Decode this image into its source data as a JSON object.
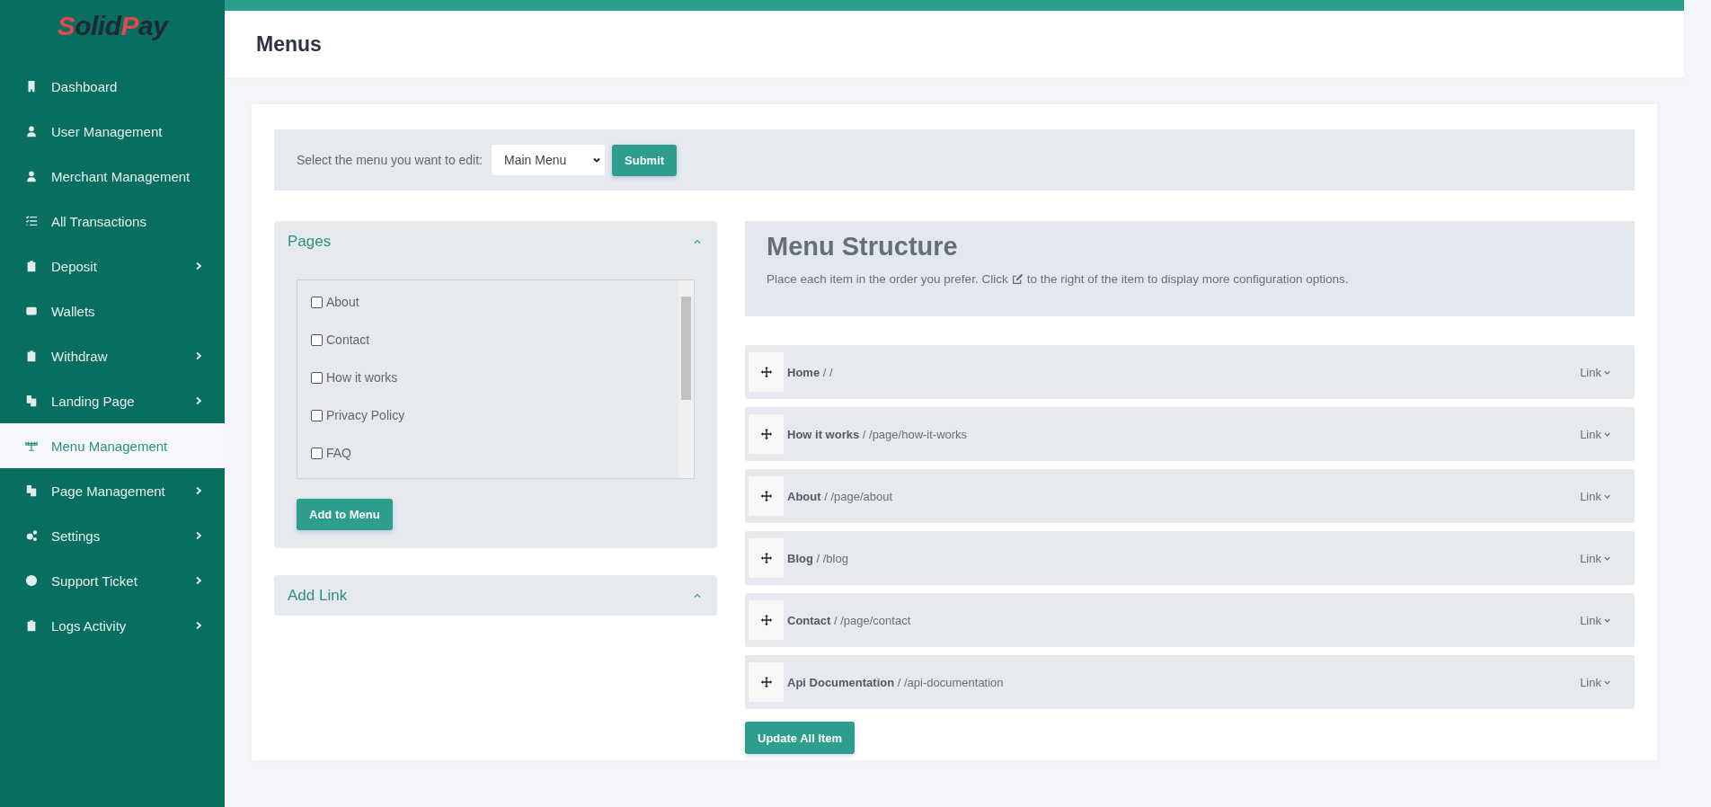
{
  "logo": {
    "parts": [
      "Solid",
      "Pay"
    ]
  },
  "sidebar": {
    "items": [
      {
        "label": "Dashboard",
        "has_submenu": false,
        "selected": false
      },
      {
        "label": "User Management",
        "has_submenu": false,
        "selected": false
      },
      {
        "label": "Merchant Management",
        "has_submenu": false,
        "selected": false
      },
      {
        "label": "All Transactions",
        "has_submenu": false,
        "selected": false
      },
      {
        "label": "Deposit",
        "has_submenu": true,
        "selected": false
      },
      {
        "label": "Wallets",
        "has_submenu": false,
        "selected": false
      },
      {
        "label": "Withdraw",
        "has_submenu": true,
        "selected": false
      },
      {
        "label": "Landing Page",
        "has_submenu": true,
        "selected": false
      },
      {
        "label": "Menu Management",
        "has_submenu": false,
        "selected": true
      },
      {
        "label": "Page Management",
        "has_submenu": true,
        "selected": false
      },
      {
        "label": "Settings",
        "has_submenu": true,
        "selected": false
      },
      {
        "label": "Support Ticket",
        "has_submenu": true,
        "selected": false
      },
      {
        "label": "Logs Activity",
        "has_submenu": true,
        "selected": false
      }
    ]
  },
  "header": {
    "title": "Menus"
  },
  "menu_select": {
    "label": "Select the menu you want to edit:",
    "value": "Main Menu",
    "button": "Submit"
  },
  "pages_panel": {
    "title": "Pages",
    "expanded": true,
    "items": [
      {
        "label": "About",
        "checked": false
      },
      {
        "label": "Contact",
        "checked": false
      },
      {
        "label": "How it works",
        "checked": false
      },
      {
        "label": "Privacy Policy",
        "checked": false
      },
      {
        "label": "FAQ",
        "checked": false
      }
    ],
    "button": "Add to Menu"
  },
  "link_panel": {
    "title": "Add Link",
    "expanded": true
  },
  "menu_structure": {
    "title": "Menu Structure",
    "description_before": "Place each item in the order you prefer. Click",
    "description_after": "to the right of the item to display more configuration options.",
    "items": [
      {
        "text": "**Home** / /",
        "type": "Link"
      },
      {
        "text": "**How it works** / /page/how-it-works",
        "type": "Link"
      },
      {
        "text": "**About** / /page/about",
        "type": "Link"
      },
      {
        "text": "**Blog** / /blog",
        "type": "Link"
      },
      {
        "text": "**Contact** / /page/contact",
        "type": "Link"
      },
      {
        "text": "**Api Documentation** / /api-documentation",
        "type": "Link"
      }
    ],
    "button": "Update All Item"
  }
}
